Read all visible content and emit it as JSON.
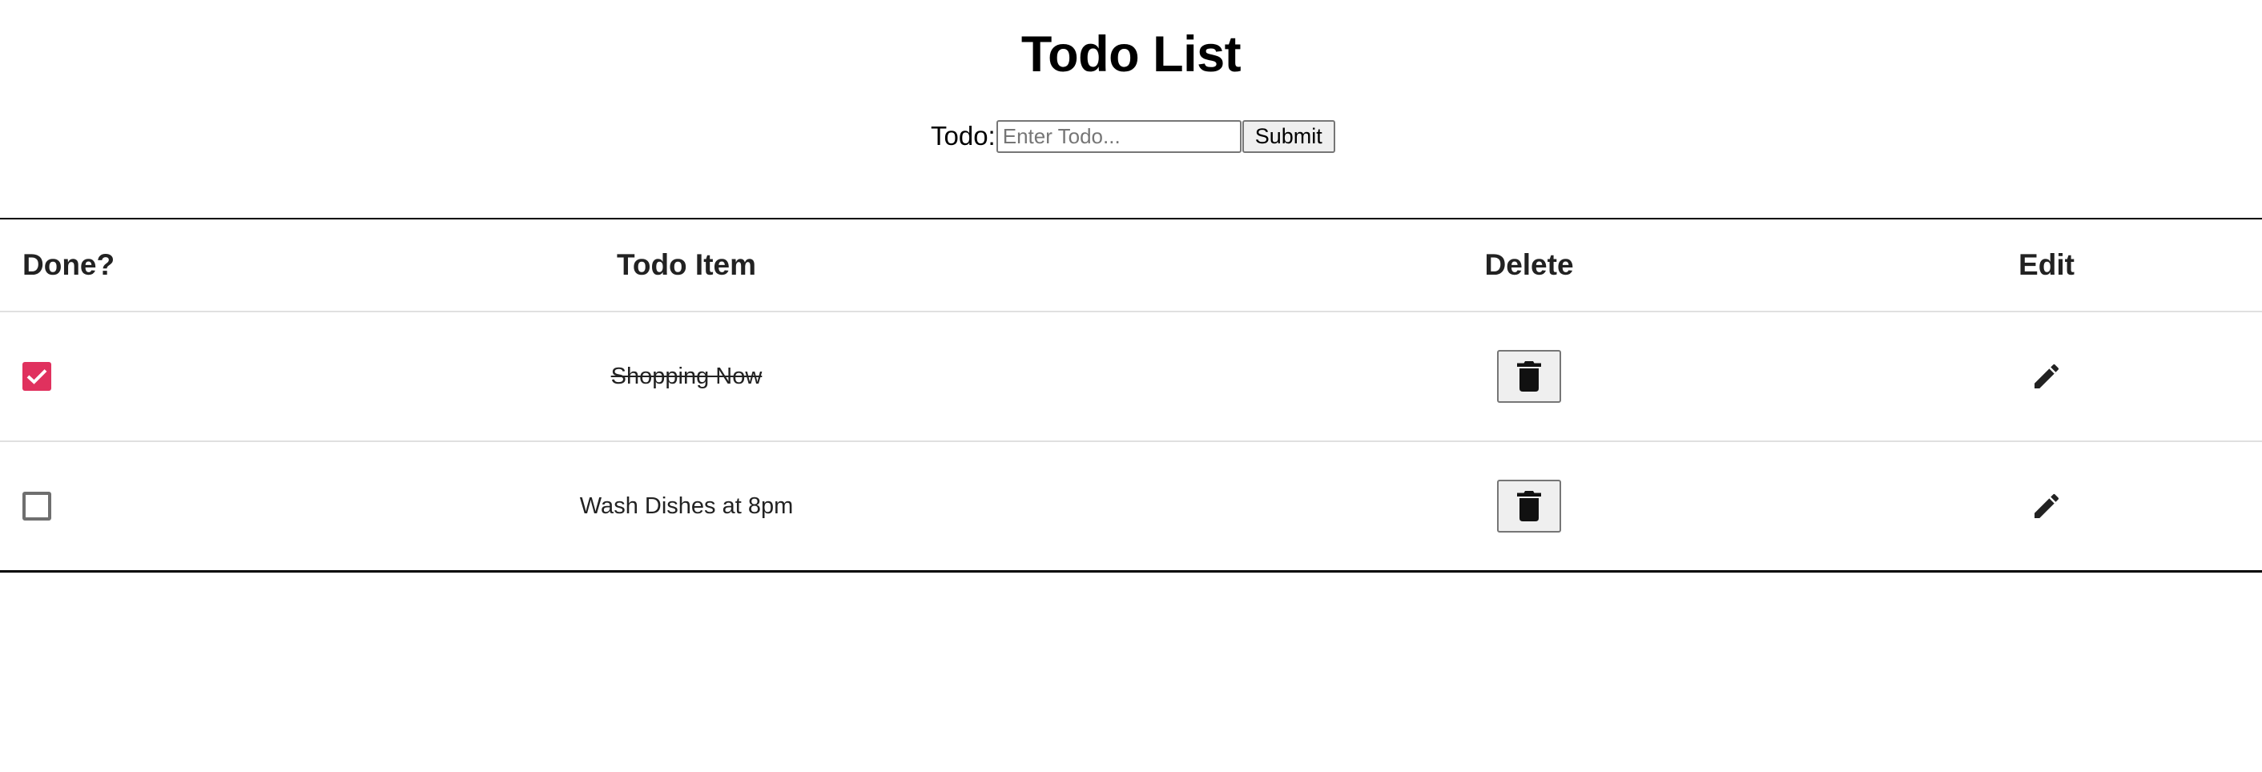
{
  "title": "Todo List",
  "form": {
    "label": "Todo:",
    "input_value": "",
    "placeholder": "Enter Todo...",
    "submit_label": "Submit"
  },
  "table": {
    "headers": {
      "done": "Done?",
      "item": "Todo Item",
      "delete": "Delete",
      "edit": "Edit"
    },
    "rows": [
      {
        "done": true,
        "text": "Shopping Now",
        "delete_icon": "trash-icon",
        "edit_icon": "pencil-icon"
      },
      {
        "done": false,
        "text": "Wash Dishes at 8pm",
        "delete_icon": "trash-icon",
        "edit_icon": "pencil-icon"
      }
    ]
  },
  "colors": {
    "checkbox_checked": "#e0315e",
    "checkbox_unchecked_border": "#6f6f6f",
    "header_text": "#222222",
    "divider": "#e0e0e0"
  }
}
